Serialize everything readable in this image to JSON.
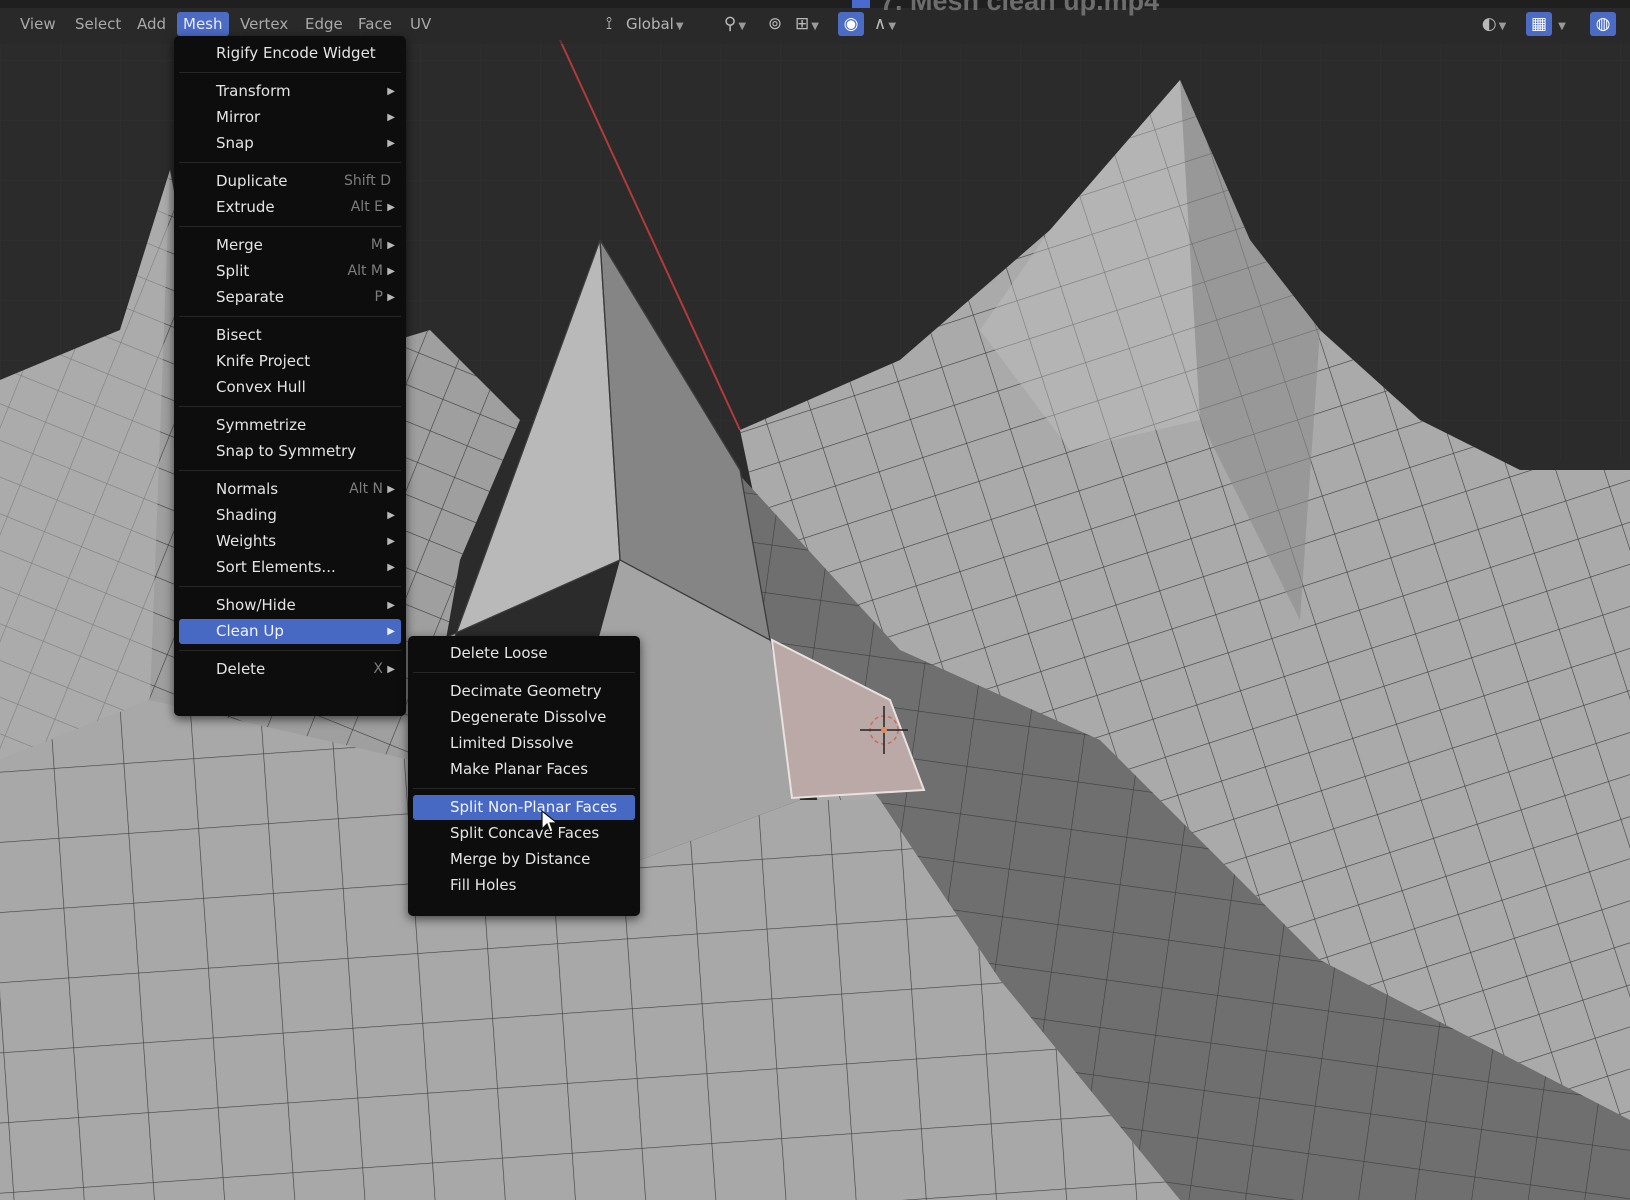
{
  "header": {
    "title": "7. Mesh clean up.mp4",
    "menus": [
      "View",
      "Select",
      "Add",
      "Mesh",
      "Vertex",
      "Edge",
      "Face",
      "UV"
    ],
    "active_menu": "Mesh",
    "orientation": "Global",
    "icons": [
      "orientation-gizmo-icon",
      "pivot-icon",
      "snap-icon",
      "snap-target-icon",
      "proportional-edit-icon",
      "falloff-icon",
      "overlay-icon",
      "xray-icon",
      "shading-icon"
    ]
  },
  "mesh_menu": {
    "items": [
      {
        "label": "Rigify Encode Widget",
        "shortcut": "",
        "submenu": false
      },
      {
        "label": "Transform",
        "shortcut": "",
        "submenu": true
      },
      {
        "label": "Mirror",
        "shortcut": "",
        "submenu": true
      },
      {
        "label": "Snap",
        "shortcut": "",
        "submenu": true
      },
      {
        "label": "Duplicate",
        "shortcut": "Shift D",
        "submenu": false
      },
      {
        "label": "Extrude",
        "shortcut": "Alt E",
        "submenu": true
      },
      {
        "label": "Merge",
        "shortcut": "M",
        "submenu": true
      },
      {
        "label": "Split",
        "shortcut": "Alt M",
        "submenu": true
      },
      {
        "label": "Separate",
        "shortcut": "P",
        "submenu": true
      },
      {
        "label": "Bisect",
        "shortcut": "",
        "submenu": false
      },
      {
        "label": "Knife Project",
        "shortcut": "",
        "submenu": false
      },
      {
        "label": "Convex Hull",
        "shortcut": "",
        "submenu": false
      },
      {
        "label": "Symmetrize",
        "shortcut": "",
        "submenu": false
      },
      {
        "label": "Snap to Symmetry",
        "shortcut": "",
        "submenu": false
      },
      {
        "label": "Normals",
        "shortcut": "Alt N",
        "submenu": true
      },
      {
        "label": "Shading",
        "shortcut": "",
        "submenu": true
      },
      {
        "label": "Weights",
        "shortcut": "",
        "submenu": true
      },
      {
        "label": "Sort Elements...",
        "shortcut": "",
        "submenu": true
      },
      {
        "label": "Show/Hide",
        "shortcut": "",
        "submenu": true
      },
      {
        "label": "Clean Up",
        "shortcut": "",
        "submenu": true
      },
      {
        "label": "Delete",
        "shortcut": "X",
        "submenu": true
      }
    ],
    "selected": "Clean Up"
  },
  "cleanup_menu": {
    "items": [
      {
        "label": "Delete Loose"
      },
      {
        "label": "Decimate Geometry"
      },
      {
        "label": "Degenerate Dissolve"
      },
      {
        "label": "Limited Dissolve"
      },
      {
        "label": "Make Planar Faces"
      },
      {
        "label": "Split Non-Planar Faces"
      },
      {
        "label": "Split Concave Faces"
      },
      {
        "label": "Merge by Distance"
      },
      {
        "label": "Fill Holes"
      }
    ],
    "selected": "Split Non-Planar Faces"
  },
  "colors": {
    "menu_bg": "#0d0d0d",
    "highlight": "#4769c4",
    "viewport_bg": "#2b2b2b",
    "mesh_face": "#a9a9a9",
    "mesh_edge": "#3c3c3c",
    "selected_face": "#b8a7a6",
    "axis_x": "#b43a3a"
  }
}
